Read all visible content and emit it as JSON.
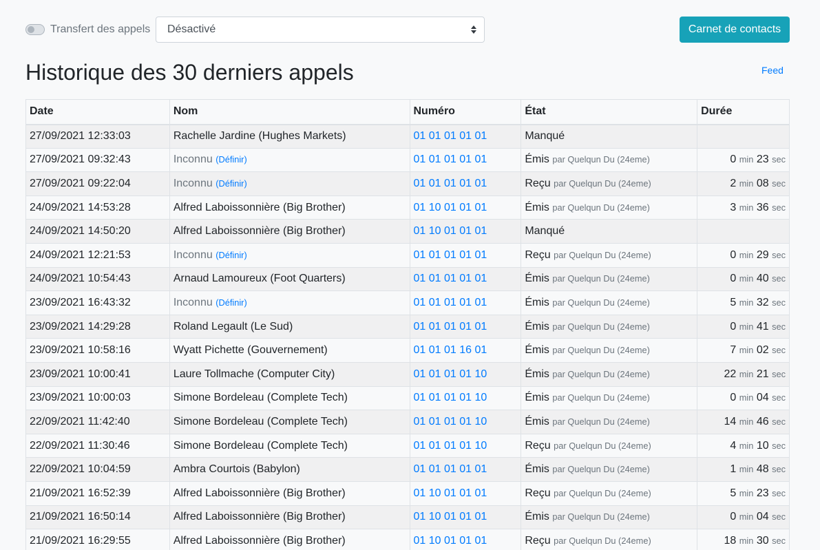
{
  "header": {
    "transfer_label": "Transfert des appels",
    "transfer_enabled": false,
    "transfer_select_value": "Désactivé",
    "contacts_button": "Carnet de contacts"
  },
  "page": {
    "title": "Historique des 30 derniers appels",
    "feed_link": "Feed"
  },
  "table": {
    "columns": [
      "Date",
      "Nom",
      "Numéro",
      "État",
      "Durée"
    ],
    "labels": {
      "define": "(Définir)",
      "by_prefix": "par",
      "min": "min",
      "sec": "sec"
    },
    "rows": [
      {
        "date": "27/09/2021 12:33:03",
        "name": "Rachelle Jardine (Hughes Markets)",
        "known": true,
        "number": "01 01 01 01 01",
        "state": "Manqué",
        "by": "",
        "min": "",
        "sec": ""
      },
      {
        "date": "27/09/2021 09:32:43",
        "name": "Inconnu",
        "known": false,
        "number": "01 01 01 01 01",
        "state": "Émis",
        "by": "Quelqun Du (24eme)",
        "min": "0",
        "sec": "23"
      },
      {
        "date": "27/09/2021 09:22:04",
        "name": "Inconnu",
        "known": false,
        "number": "01 01 01 01 01",
        "state": "Reçu",
        "by": "Quelqun Du (24eme)",
        "min": "2",
        "sec": "08"
      },
      {
        "date": "24/09/2021 14:53:28",
        "name": "Alfred Laboissonnière (Big Brother)",
        "known": true,
        "number": "01 10 01 01 01",
        "state": "Émis",
        "by": "Quelqun Du (24eme)",
        "min": "3",
        "sec": "36"
      },
      {
        "date": "24/09/2021 14:50:20",
        "name": "Alfred Laboissonnière (Big Brother)",
        "known": true,
        "number": "01 10 01 01 01",
        "state": "Manqué",
        "by": "",
        "min": "",
        "sec": ""
      },
      {
        "date": "24/09/2021 12:21:53",
        "name": "Inconnu",
        "known": false,
        "number": "01 01 01 01 01",
        "state": "Reçu",
        "by": "Quelqun Du (24eme)",
        "min": "0",
        "sec": "29"
      },
      {
        "date": "24/09/2021 10:54:43",
        "name": "Arnaud Lamoureux (Foot Quarters)",
        "known": true,
        "number": "01 01 01 01 01",
        "state": "Émis",
        "by": "Quelqun Du (24eme)",
        "min": "0",
        "sec": "40"
      },
      {
        "date": "23/09/2021 16:43:32",
        "name": "Inconnu",
        "known": false,
        "number": "01 01 01 01 01",
        "state": "Émis",
        "by": "Quelqun Du (24eme)",
        "min": "5",
        "sec": "32"
      },
      {
        "date": "23/09/2021 14:29:28",
        "name": "Roland Legault (Le Sud)",
        "known": true,
        "number": "01 01 01 01 01",
        "state": "Émis",
        "by": "Quelqun Du (24eme)",
        "min": "0",
        "sec": "41"
      },
      {
        "date": "23/09/2021 10:58:16",
        "name": "Wyatt Pichette (Gouvernement)",
        "known": true,
        "number": "01 01 01 16 01",
        "state": "Émis",
        "by": "Quelqun Du (24eme)",
        "min": "7",
        "sec": "02"
      },
      {
        "date": "23/09/2021 10:00:41",
        "name": "Laure Tollmache (Computer City)",
        "known": true,
        "number": "01 01 01 01 10",
        "state": "Émis",
        "by": "Quelqun Du (24eme)",
        "min": "22",
        "sec": "21"
      },
      {
        "date": "23/09/2021 10:00:03",
        "name": "Simone Bordeleau (Complete Tech)",
        "known": true,
        "number": "01 01 01 01 10",
        "state": "Émis",
        "by": "Quelqun Du (24eme)",
        "min": "0",
        "sec": "04"
      },
      {
        "date": "22/09/2021 11:42:40",
        "name": "Simone Bordeleau (Complete Tech)",
        "known": true,
        "number": "01 01 01 01 10",
        "state": "Émis",
        "by": "Quelqun Du (24eme)",
        "min": "14",
        "sec": "46"
      },
      {
        "date": "22/09/2021 11:30:46",
        "name": "Simone Bordeleau (Complete Tech)",
        "known": true,
        "number": "01 01 01 01 10",
        "state": "Reçu",
        "by": "Quelqun Du (24eme)",
        "min": "4",
        "sec": "10"
      },
      {
        "date": "22/09/2021 10:04:59",
        "name": "Ambra Courtois (Babylon)",
        "known": true,
        "number": "01 01 01 01 01",
        "state": "Émis",
        "by": "Quelqun Du (24eme)",
        "min": "1",
        "sec": "48"
      },
      {
        "date": "21/09/2021 16:52:39",
        "name": "Alfred Laboissonnière (Big Brother)",
        "known": true,
        "number": "01 10 01 01 01",
        "state": "Reçu",
        "by": "Quelqun Du (24eme)",
        "min": "5",
        "sec": "23"
      },
      {
        "date": "21/09/2021 16:50:14",
        "name": "Alfred Laboissonnière (Big Brother)",
        "known": true,
        "number": "01 10 01 01 01",
        "state": "Émis",
        "by": "Quelqun Du (24eme)",
        "min": "0",
        "sec": "04"
      },
      {
        "date": "21/09/2021 16:29:55",
        "name": "Alfred Laboissonnière (Big Brother)",
        "known": true,
        "number": "01 10 01 01 01",
        "state": "Reçu",
        "by": "Quelqun Du (24eme)",
        "min": "18",
        "sec": "30"
      }
    ]
  }
}
